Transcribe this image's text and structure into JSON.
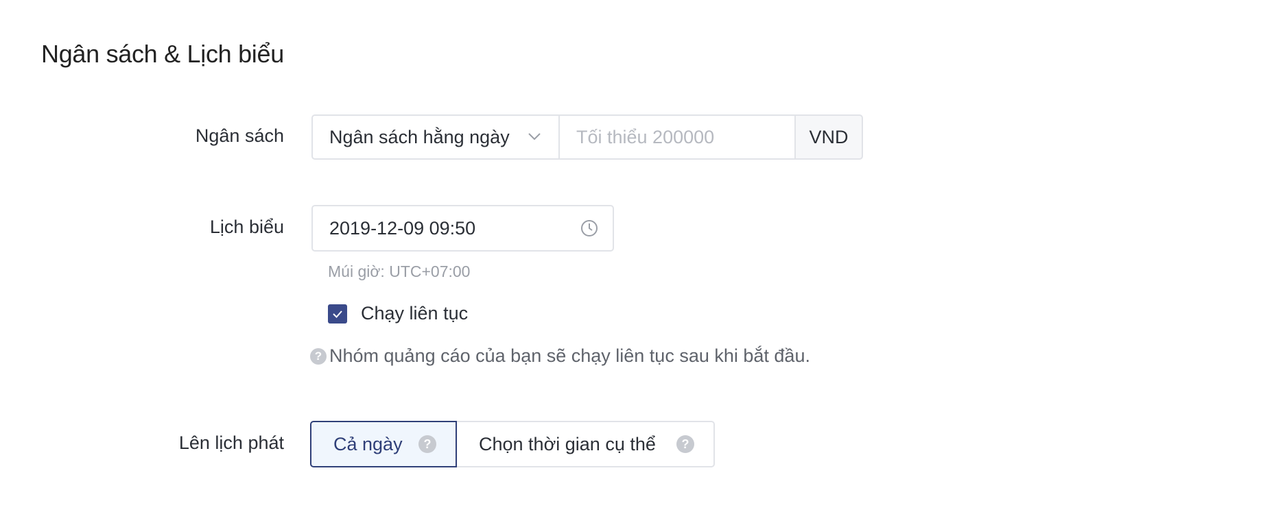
{
  "section": {
    "title": "Ngân sách & Lịch biểu"
  },
  "budget": {
    "label": "Ngân sách",
    "type_selected": "Ngân sách hằng ngày",
    "amount_value": "",
    "amount_placeholder": "Tối thiểu 200000",
    "currency": "VND"
  },
  "schedule": {
    "label": "Lịch biểu",
    "start_datetime": "2019-12-09 09:50",
    "timezone_note": "Múi giờ: UTC+07:00",
    "continuous_label": "Chạy liên tục",
    "continuous_checked": true,
    "hint": "Nhóm quảng cáo của bạn sẽ chạy liên tục sau khi bắt đầu."
  },
  "delivery": {
    "label": "Lên lịch phát",
    "options": [
      {
        "label": "Cả ngày",
        "selected": true
      },
      {
        "label": "Chọn thời gian cụ thể",
        "selected": false
      }
    ]
  },
  "colors": {
    "accent": "#2f3f78",
    "checkbox": "#3a4a8a",
    "border": "#e1e3e8",
    "active_bg": "#f0f6fd"
  },
  "icons": {
    "select_chevron": "chevron-down-icon",
    "date_clock": "clock-icon",
    "checkbox_check": "check-icon",
    "help": "question-circle-icon"
  }
}
